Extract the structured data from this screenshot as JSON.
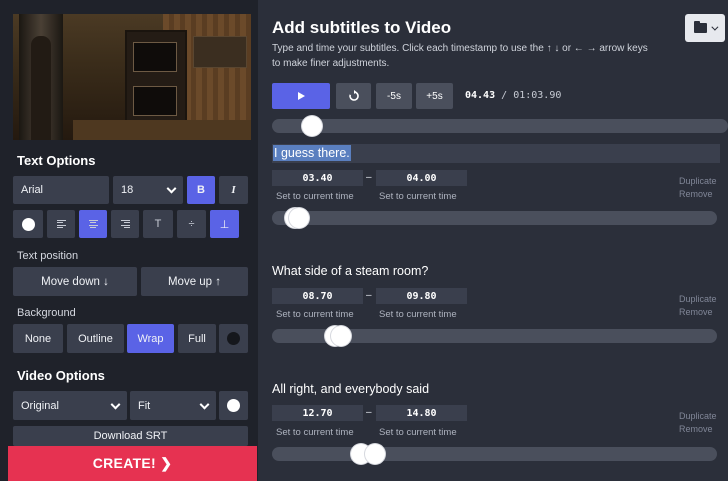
{
  "left_panel": {
    "text_options": {
      "title": "Text Options",
      "font": "Arial",
      "size": "18",
      "bold_label": "B",
      "italic_label": "I",
      "align_top_label": "T",
      "align_middle_label": "÷",
      "align_bottom_label": "⊥"
    },
    "text_position": {
      "title": "Text position",
      "move_down_label": "Move down ↓",
      "move_up_label": "Move up ↑"
    },
    "background": {
      "title": "Background",
      "options": [
        "None",
        "Outline",
        "Wrap",
        "Full"
      ],
      "selected": "Wrap"
    },
    "video_options": {
      "title": "Video Options",
      "aspect": "Original",
      "fit": "Fit",
      "download_label": "Download SRT"
    },
    "create_label": "CREATE! ❯"
  },
  "header": {
    "title": "Add subtitles to Video",
    "description": "Type and time your subtitles. Click each timestamp to use the ↑ ↓ or ← → arrow keys to make finer adjustments."
  },
  "player": {
    "rewind_5_label": "-5s",
    "forward_5_label": "+5s",
    "current_time": "04.43",
    "separator": "/",
    "total_time": "01:03.90",
    "progress_fraction": 0.069
  },
  "cues": [
    {
      "text": "I guess there.",
      "start": "03.40",
      "end": "04.00",
      "set_current": "Set to current time",
      "duplicate": "Duplicate",
      "remove": "Remove"
    },
    {
      "text": "What side of a steam room?",
      "start": "08.70",
      "end": "09.80",
      "set_current": "Set to current time",
      "duplicate": "Duplicate",
      "remove": "Remove"
    },
    {
      "text": "All right, and everybody said",
      "start": "12.70",
      "end": "14.80",
      "set_current": "Set to current time",
      "duplicate": "Duplicate",
      "remove": "Remove"
    }
  ],
  "colors": {
    "accent": "#5a63e6",
    "create": "#e63251",
    "panel_bg": "#1f222a",
    "main_bg": "#2b2f3a"
  }
}
